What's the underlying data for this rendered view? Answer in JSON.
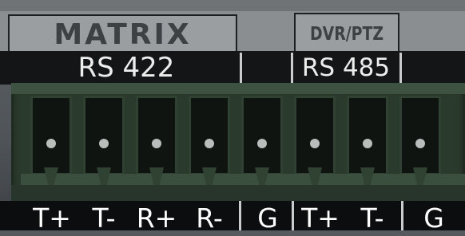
{
  "header": {
    "left_title": "MATRIX",
    "right_title": "DVR/PTZ"
  },
  "protocols": {
    "left": "RS 422",
    "right": "RS 485"
  },
  "pins": [
    {
      "label": "T+"
    },
    {
      "label": "T-"
    },
    {
      "label": "R+"
    },
    {
      "label": "R-"
    },
    {
      "label": "G"
    },
    {
      "label": "T+"
    },
    {
      "label": "T-"
    },
    {
      "label": "G"
    }
  ],
  "colors": {
    "connector": "#2a3a2c",
    "label_strip": "#141517",
    "plate": "#8a8e91"
  }
}
